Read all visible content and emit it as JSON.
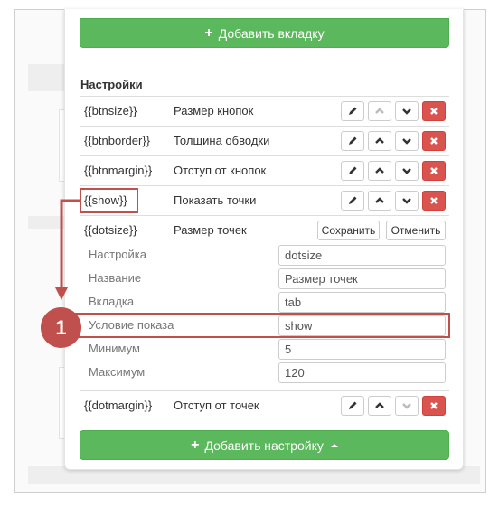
{
  "panel": {
    "add_tab_label": "Добавить вкладку",
    "settings_title": "Настройки",
    "add_setting_label": "Добавить настройку"
  },
  "settings": [
    {
      "key": "{{btnsize}}",
      "label": "Размер кнопок"
    },
    {
      "key": "{{btnborder}}",
      "label": "Толщина обводки"
    },
    {
      "key": "{{btnmargin}}",
      "label": "Отступ от кнопок"
    },
    {
      "key": "{{show}}",
      "label": "Показать точки"
    }
  ],
  "editing": {
    "key": "{{dotsize}}",
    "label": "Размер точек",
    "save_label": "Сохранить",
    "cancel_label": "Отменить",
    "fields": [
      {
        "label": "Настройка",
        "value": "dotsize"
      },
      {
        "label": "Название",
        "value": "Размер точек"
      },
      {
        "label": "Вкладка",
        "value": "tab"
      },
      {
        "label": "Условие показа",
        "value": "show"
      },
      {
        "label": "Минимум",
        "value": "5"
      },
      {
        "label": "Максимум",
        "value": "120"
      }
    ]
  },
  "last_setting": {
    "key": "{{dotmargin}}",
    "label": "Отступ от точек"
  },
  "annotation": {
    "badge_number": "1",
    "color": "#c0504d"
  },
  "colors": {
    "green": "#5cb85c",
    "red": "#d9534f"
  }
}
